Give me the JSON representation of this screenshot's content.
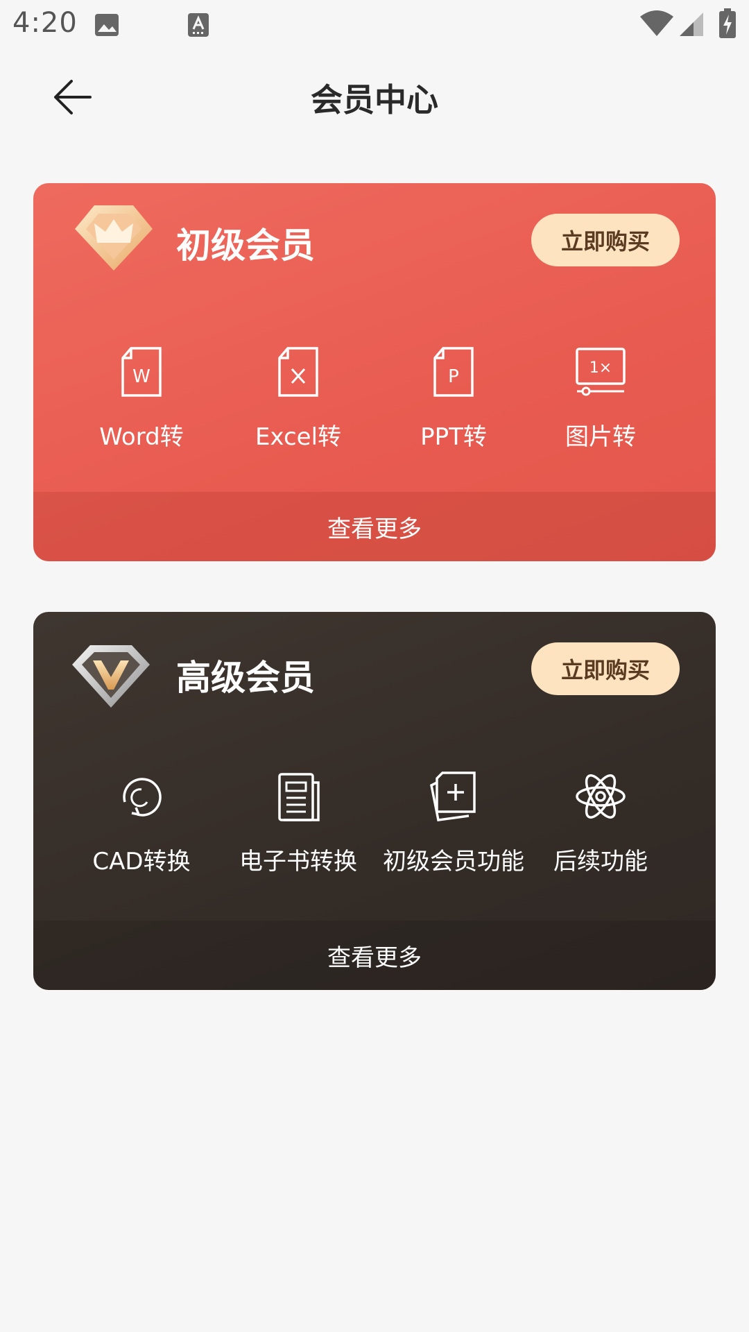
{
  "status_bar": {
    "time": "4:20",
    "icons": [
      "image-icon",
      "keyboard-a-icon",
      "wifi-icon",
      "signal-icon",
      "battery-charging-icon"
    ]
  },
  "header": {
    "back_icon": "arrow-left-icon",
    "title": "会员中心"
  },
  "cards": [
    {
      "badge_icon": "diamond-crown-badge-icon",
      "title": "初级会员",
      "buy_label": "立即购买",
      "background": "#e85b50",
      "features": [
        {
          "icon": "word-file-icon",
          "label": "Word转"
        },
        {
          "icon": "excel-file-icon",
          "label": "Excel转"
        },
        {
          "icon": "ppt-file-icon",
          "label": "PPT转"
        },
        {
          "icon": "image-screen-icon",
          "label": "图片转"
        }
      ],
      "more_label": "查看更多"
    },
    {
      "badge_icon": "diamond-v-badge-icon",
      "title": "高级会员",
      "buy_label": "立即购买",
      "background": "#342c27",
      "features": [
        {
          "icon": "refresh-icon",
          "label": "CAD转换"
        },
        {
          "icon": "ebook-icon",
          "label": "电子书转换"
        },
        {
          "icon": "add-document-icon",
          "label": "初级会员功能"
        },
        {
          "icon": "atom-icon",
          "label": "后续功能"
        }
      ],
      "more_label": "查看更多"
    }
  ],
  "colors": {
    "background": "#f6f6f7",
    "buy_button": "#fde3bf",
    "buy_button_text": "#5a3a20"
  }
}
